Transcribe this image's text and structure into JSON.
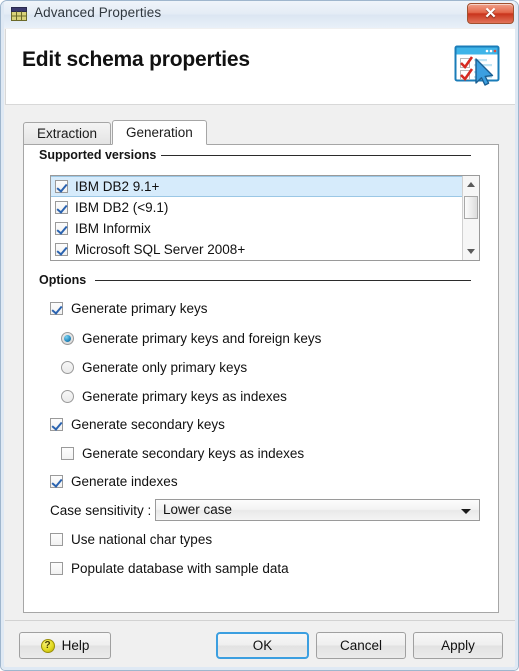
{
  "window": {
    "title": "Advanced Properties",
    "title_icon": "table-icon",
    "close_label": "✕",
    "close_icon": "close-icon"
  },
  "header": {
    "title": "Edit schema properties",
    "icon": "schema-checklist-icon"
  },
  "tabs": [
    {
      "label": "Extraction",
      "active": false
    },
    {
      "label": "Generation",
      "active": true
    }
  ],
  "supported_versions": {
    "group_label": "Supported versions",
    "items": [
      {
        "label": "IBM DB2 9.1+",
        "checked": true,
        "selected": true
      },
      {
        "label": "IBM DB2 (<9.1)",
        "checked": true,
        "selected": false
      },
      {
        "label": "IBM Informix",
        "checked": true,
        "selected": false
      },
      {
        "label": "Microsoft SQL Server 2008+",
        "checked": true,
        "selected": false
      }
    ],
    "scrollbar": {
      "up_icon": "scroll-up-arrow-icon",
      "down_icon": "scroll-down-arrow-icon",
      "thumb_icon": "scrollbar-thumb"
    }
  },
  "options": {
    "group_label": "Options",
    "generate_primary_keys": {
      "label": "Generate primary keys",
      "checked": true
    },
    "primary_key_mode": [
      {
        "label": "Generate primary keys and foreign keys",
        "selected": true
      },
      {
        "label": "Generate only primary keys",
        "selected": false
      },
      {
        "label": "Generate primary keys as indexes",
        "selected": false
      }
    ],
    "generate_secondary_keys": {
      "label": "Generate secondary keys",
      "checked": true
    },
    "generate_secondary_keys_as_indexes": {
      "label": "Generate secondary keys as indexes",
      "checked": false
    },
    "generate_indexes": {
      "label": "Generate indexes",
      "checked": true
    },
    "case_sensitivity": {
      "label": "Case sensitivity :",
      "value": "Lower case",
      "arrow_icon": "chevron-down-icon"
    },
    "use_national_char_types": {
      "label": "Use national char types",
      "checked": false
    },
    "populate_database_with_sample_data": {
      "label": "Populate database with sample data",
      "checked": false
    }
  },
  "footer": {
    "help_label": "Help",
    "help_icon": "help-question-icon",
    "ok_label": "OK",
    "cancel_label": "Cancel",
    "apply_label": "Apply"
  }
}
